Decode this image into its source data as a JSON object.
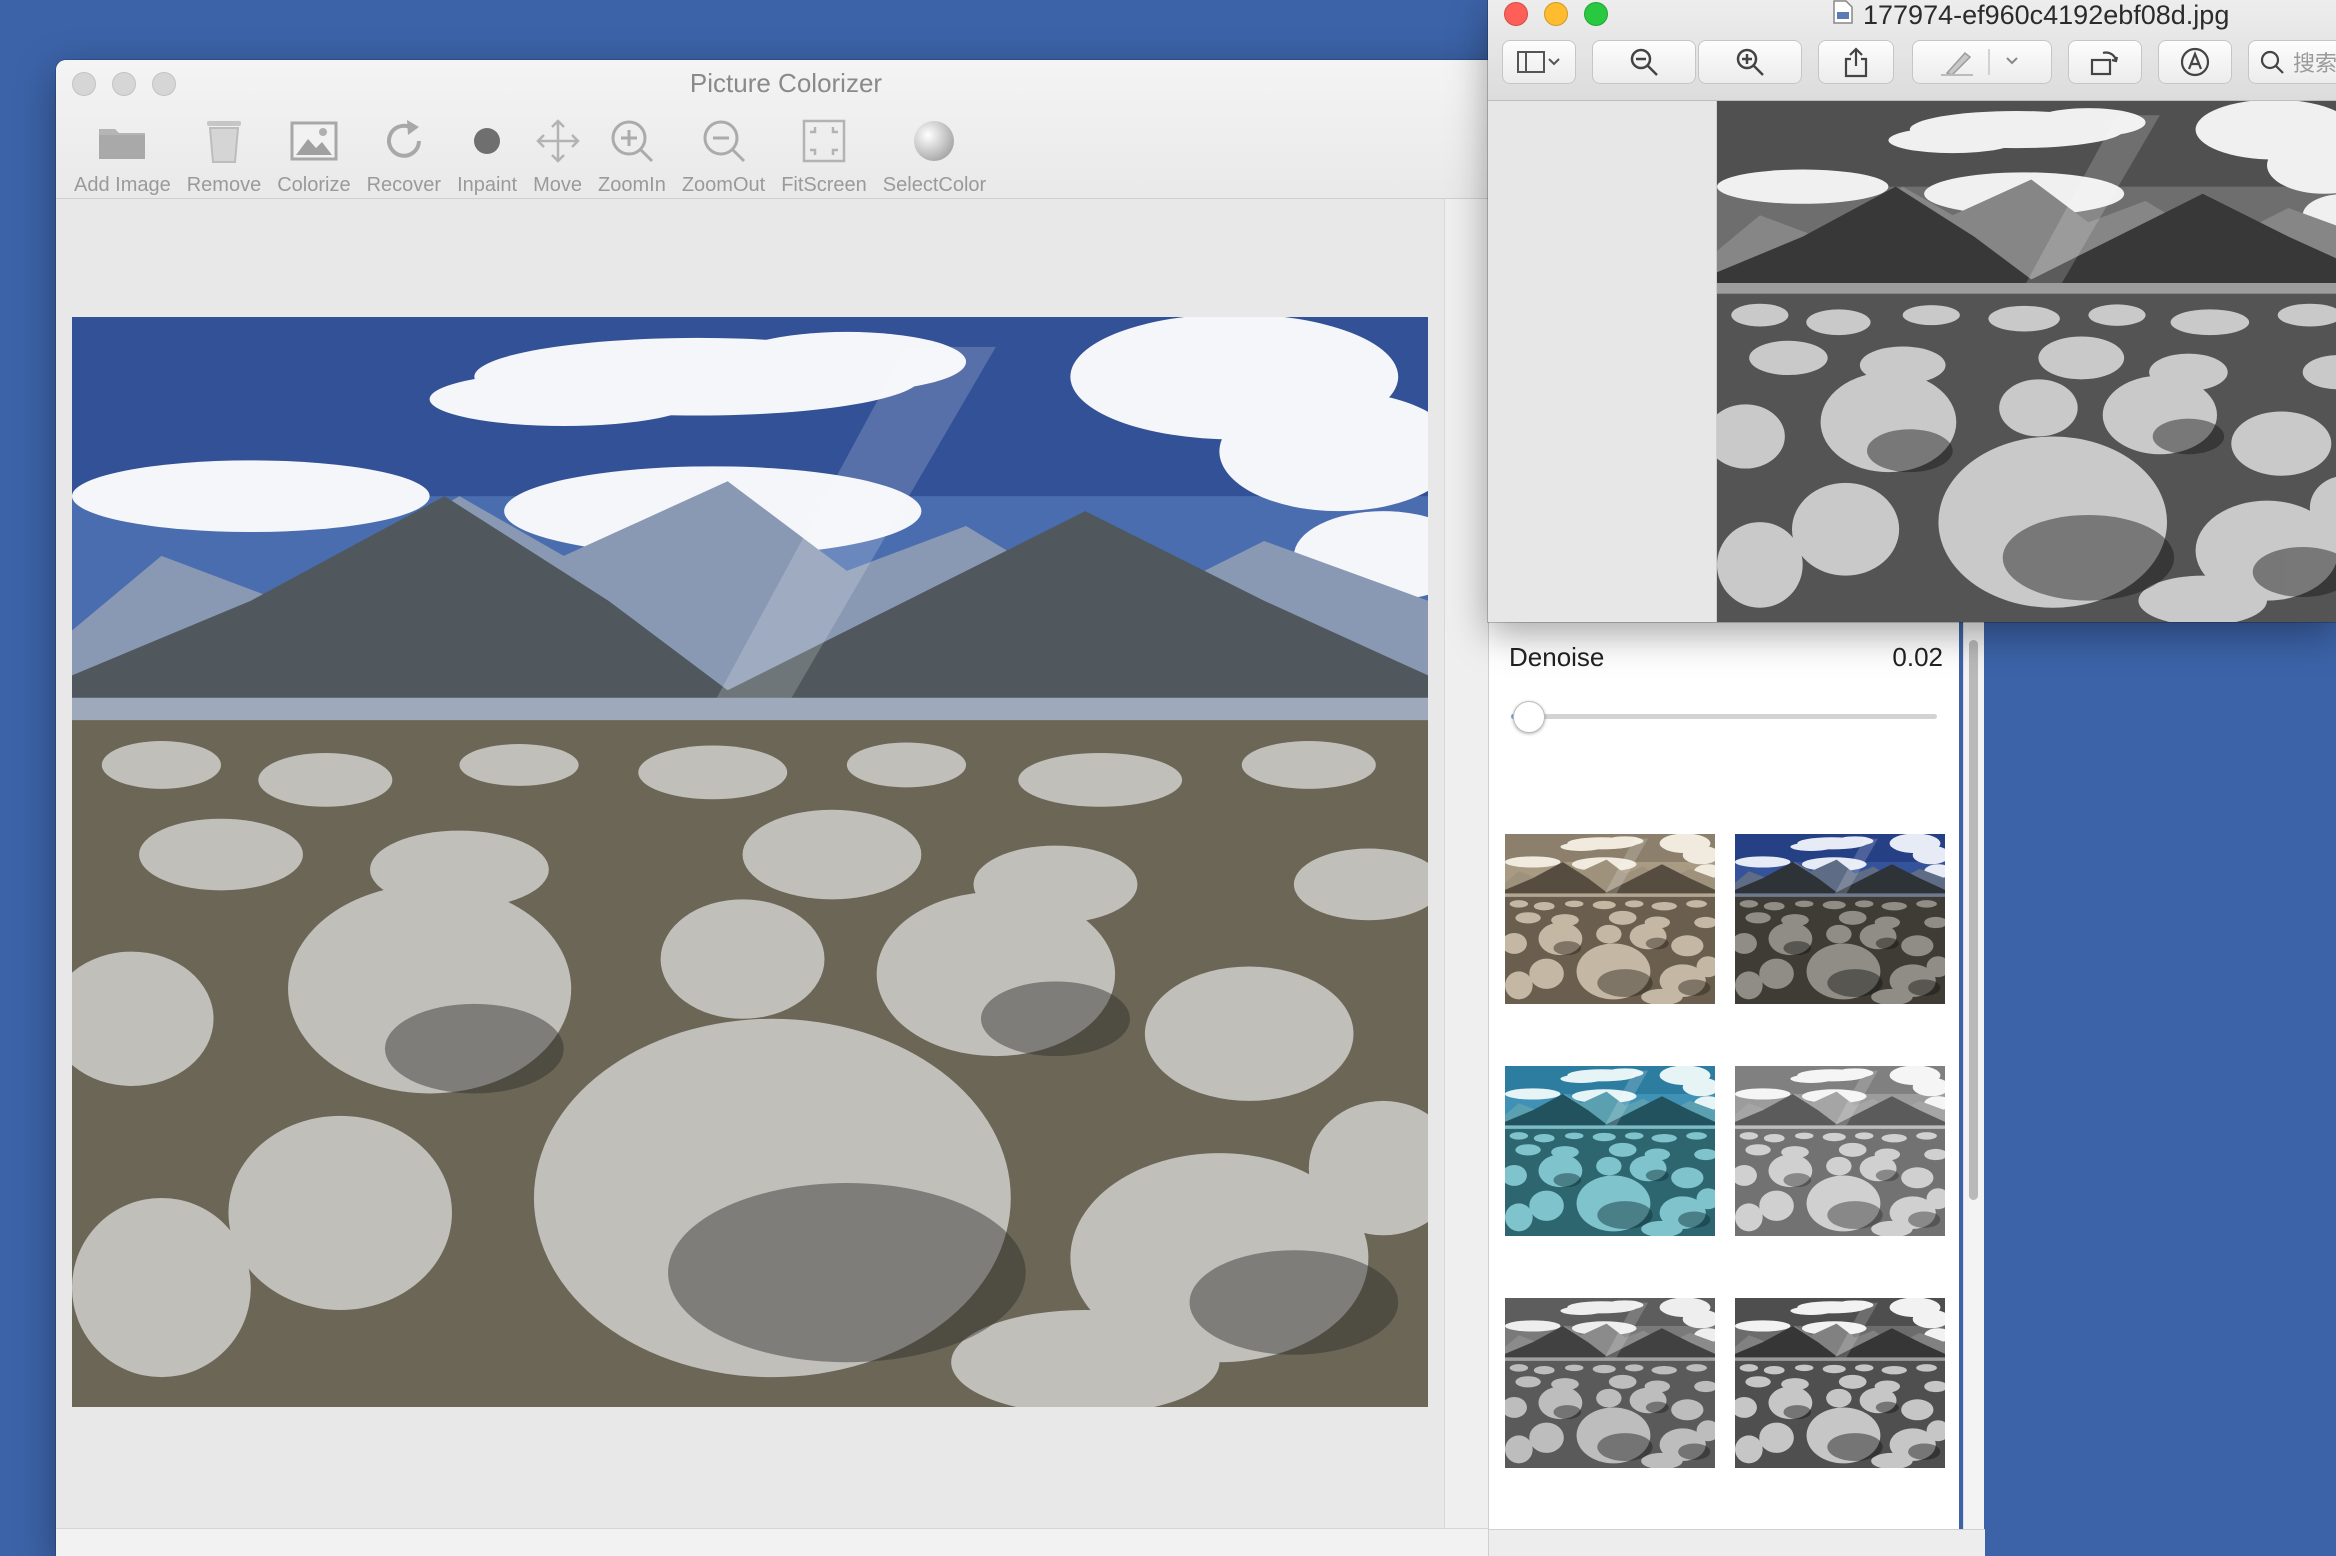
{
  "main_window": {
    "title": "Picture Colorizer",
    "toolbar": [
      {
        "label": "Add Image",
        "icon": "folder-icon"
      },
      {
        "label": "Remove",
        "icon": "trash-icon"
      },
      {
        "label": "Colorize",
        "icon": "image-icon"
      },
      {
        "label": "Recover",
        "icon": "recover-icon"
      },
      {
        "label": "Inpaint",
        "icon": "dot-icon"
      },
      {
        "label": "Move",
        "icon": "move-icon"
      },
      {
        "label": "ZoomIn",
        "icon": "zoom-in-icon"
      },
      {
        "label": "ZoomOut",
        "icon": "zoom-out-icon"
      },
      {
        "label": "FitScreen",
        "icon": "fit-screen-icon"
      },
      {
        "label": "SelectColor",
        "icon": "color-sphere-icon"
      }
    ]
  },
  "side_panel": {
    "denoise_label": "Denoise",
    "denoise_value": "0.02",
    "denoise_fraction": 0.04,
    "thumbnails": [
      "sepia",
      "blue-dark",
      "teal-cyan",
      "grayscale-light",
      "grayscale-mid",
      "grayscale-contrast"
    ]
  },
  "preview_window": {
    "title": "177974-ef960c4192ebf08d.jpg",
    "search_placeholder": "搜索",
    "traffic_colors": [
      "#fe5f57",
      "#febc2e",
      "#28c840"
    ]
  },
  "colors": {
    "desktop": "#3c63a8",
    "accent": "#7ea5e8"
  }
}
